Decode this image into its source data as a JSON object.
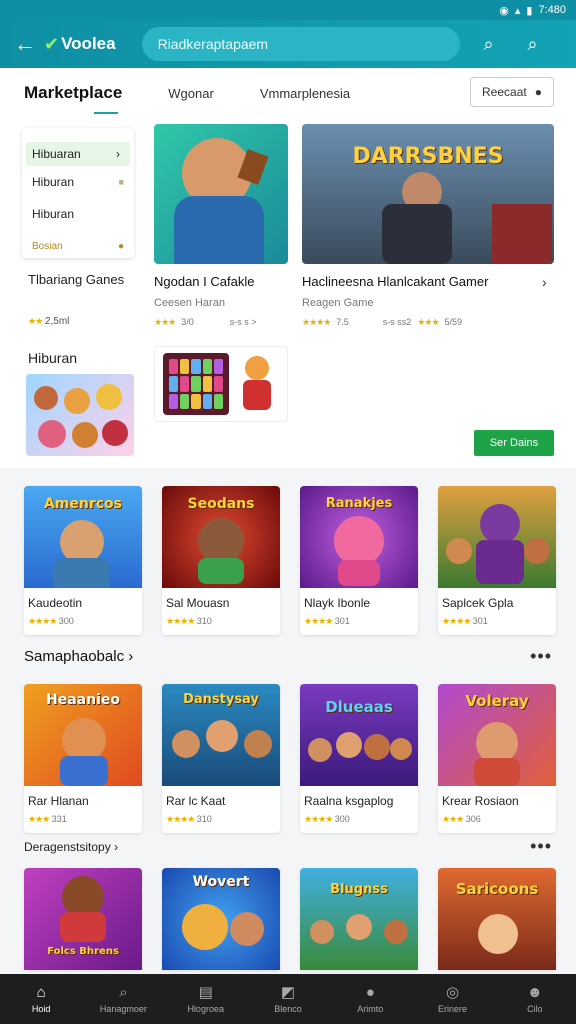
{
  "status": {
    "time": "7:480"
  },
  "appbar": {
    "brand": "Voolea",
    "search_placeholder": "Riadkeraptapaem"
  },
  "tabs": {
    "marketplace": "Marketplace",
    "tab2": "Wgonar",
    "tab3": "Vmmarplenesia",
    "button": "Reecaat"
  },
  "side_menu": {
    "items": [
      "Hibuaran",
      "Hiburan",
      "Hiburan",
      "Bosian"
    ]
  },
  "side": {
    "title": "Tlbariang Ganes",
    "rating": "2,5ml",
    "heading": "Hiburan"
  },
  "featured": [
    {
      "title": "Ngodan I Cafakle",
      "sub": "Ceesen Haran",
      "rating": "3/0",
      "meta": "s-s s >"
    },
    {
      "title": "Haclineesna Hlanlcakant Gamer",
      "sub": "Reagen Game",
      "rating": "7.5",
      "meta": "s-s ss2",
      "rating2": "5/59"
    }
  ],
  "featured_button": "Ser Dains",
  "row1": [
    {
      "name": "Kaudeotin",
      "rating": "300",
      "art": "Amenrcos"
    },
    {
      "name": "Sal Mouasn",
      "rating": "310",
      "art": "Seodans"
    },
    {
      "name": "Nlayk Ibonle",
      "rating": "301",
      "art": "Ranakjes"
    },
    {
      "name": "Saplcek Gpla",
      "rating": "301",
      "art": ""
    }
  ],
  "section2": "Samaphaobalc",
  "row2": [
    {
      "name": "Rar Hlanan",
      "rating": "331",
      "art": "Heaanieo"
    },
    {
      "name": "Rar lc Kaat",
      "rating": "310",
      "art": "Danstysay"
    },
    {
      "name": "Raalna ksgaplog",
      "rating": "300",
      "art": "Dlueaas"
    },
    {
      "name": "Krear Rosiaon",
      "rating": "306",
      "art": "Voleray"
    }
  ],
  "section3": "Deragenstsitopy",
  "row3": [
    {
      "name": "",
      "rating": "",
      "art": "Folcs Bhrens"
    },
    {
      "name": "",
      "rating": "",
      "art": "Wovert"
    },
    {
      "name": "",
      "rating": "",
      "art": "Blugnss"
    },
    {
      "name": "",
      "rating": "",
      "art": "Saricoons"
    }
  ],
  "nav": [
    "Hoid",
    "Hanagmoer",
    "Hlogroea",
    "Blenco",
    "Arimto",
    "Erinere",
    "Cilo"
  ]
}
